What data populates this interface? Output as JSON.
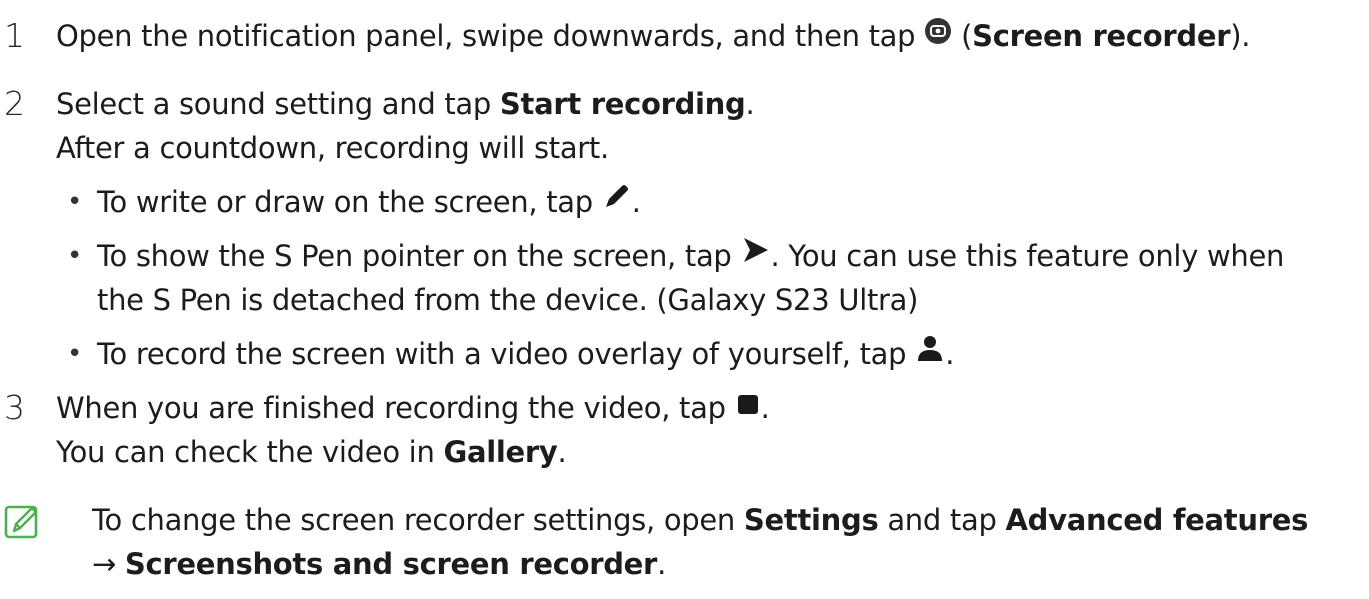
{
  "steps": [
    {
      "number": "1",
      "text_before": "Open the notification panel, swipe downwards, and then tap ",
      "icon": "screen-recorder-icon",
      "text_after_open": " (",
      "bold": "Screen recorder",
      "text_after": ")."
    },
    {
      "number": "2",
      "text_before": "Select a sound setting and tap ",
      "bold": "Start recording",
      "text_after": ".",
      "subtext": "After a countdown, recording will start.",
      "bullets": [
        {
          "text_before": "To write or draw on the screen, tap ",
          "icon": "pen-icon",
          "text_after": "."
        },
        {
          "text_before": "To show the S Pen pointer on the screen, tap ",
          "icon": "pointer-icon",
          "text_after": ". You can use this feature only when",
          "continuation": "the S Pen is detached from the device. (Galaxy S23 Ultra)"
        },
        {
          "text_before": "To record the screen with a video overlay of yourself, tap ",
          "icon": "person-icon",
          "text_after": "."
        }
      ]
    },
    {
      "number": "3",
      "text_before": "When you are finished recording the video, tap ",
      "icon": "stop-icon",
      "text_after": ".",
      "subtext_before": "You can check the video in ",
      "subtext_bold": "Gallery",
      "subtext_after": "."
    }
  ],
  "note": {
    "icon": "note-icon",
    "text_before": "To change the screen recorder settings, open ",
    "bold1": "Settings",
    "text_mid": " and tap ",
    "bold2": "Advanced features",
    "arrow": "→ ",
    "bold3": "Screenshots and screen recorder",
    "text_after": "."
  },
  "colors": {
    "text": "#1c1c1c",
    "icon_dark": "#1a1a1a",
    "note_icon": "#4caf50"
  }
}
